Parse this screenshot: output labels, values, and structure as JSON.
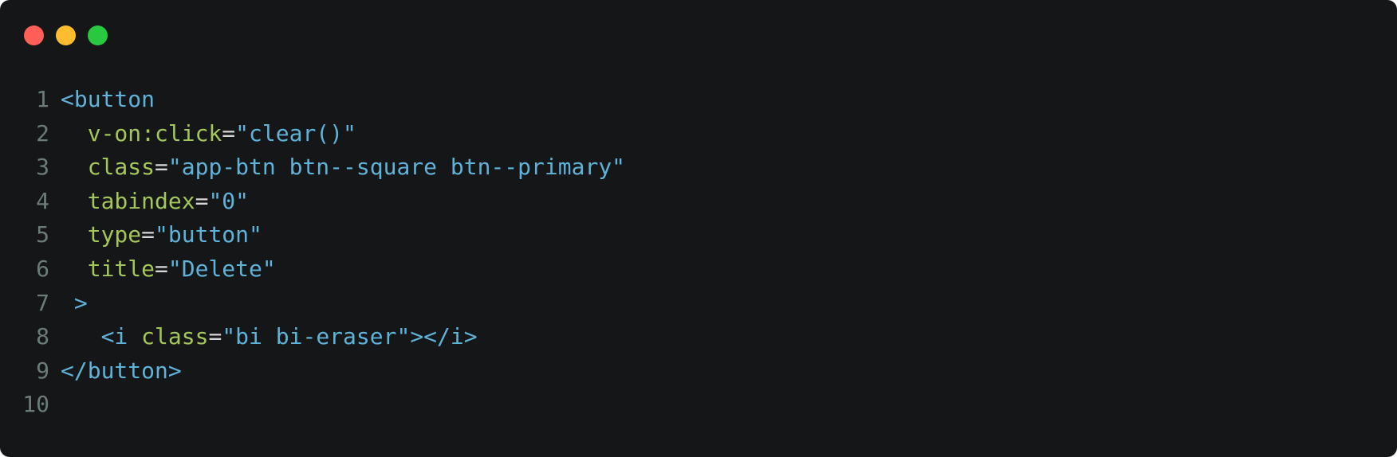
{
  "window": {
    "controls": [
      {
        "name": "close",
        "color": "#ff5f57"
      },
      {
        "name": "minimize",
        "color": "#febc2e"
      },
      {
        "name": "maximize",
        "color": "#28c840"
      }
    ]
  },
  "colors": {
    "background": "#151618",
    "line_number": "#6b7c78",
    "tag": "#5fb3d9",
    "attribute": "#a3c75a",
    "string": "#5fb3d9",
    "punctuation": "#d7d7d7"
  },
  "code": {
    "lines": [
      {
        "num": "1",
        "tokens": [
          {
            "t": "<button",
            "k": "tag"
          }
        ]
      },
      {
        "num": "2",
        "tokens": [
          {
            "t": "  ",
            "k": "punct"
          },
          {
            "t": "v-on:click",
            "k": "attr"
          },
          {
            "t": "=",
            "k": "punct"
          },
          {
            "t": "\"clear()\"",
            "k": "str"
          }
        ]
      },
      {
        "num": "3",
        "tokens": [
          {
            "t": "  ",
            "k": "punct"
          },
          {
            "t": "class",
            "k": "attr"
          },
          {
            "t": "=",
            "k": "punct"
          },
          {
            "t": "\"app-btn btn--square btn--primary\"",
            "k": "str"
          }
        ]
      },
      {
        "num": "4",
        "tokens": [
          {
            "t": "  ",
            "k": "punct"
          },
          {
            "t": "tabindex",
            "k": "attr"
          },
          {
            "t": "=",
            "k": "punct"
          },
          {
            "t": "\"0\"",
            "k": "str"
          }
        ]
      },
      {
        "num": "5",
        "tokens": [
          {
            "t": "  ",
            "k": "punct"
          },
          {
            "t": "type",
            "k": "attr"
          },
          {
            "t": "=",
            "k": "punct"
          },
          {
            "t": "\"button\"",
            "k": "str"
          }
        ]
      },
      {
        "num": "6",
        "tokens": [
          {
            "t": "  ",
            "k": "punct"
          },
          {
            "t": "title",
            "k": "attr"
          },
          {
            "t": "=",
            "k": "punct"
          },
          {
            "t": "\"Delete\"",
            "k": "str"
          }
        ]
      },
      {
        "num": "7",
        "tokens": [
          {
            "t": " ",
            "k": "punct"
          },
          {
            "t": ">",
            "k": "tag"
          }
        ]
      },
      {
        "num": "8",
        "tokens": [
          {
            "t": "   ",
            "k": "punct"
          },
          {
            "t": "<i ",
            "k": "tag"
          },
          {
            "t": "class",
            "k": "attr"
          },
          {
            "t": "=",
            "k": "punct"
          },
          {
            "t": "\"bi bi-eraser\"",
            "k": "str"
          },
          {
            "t": "></i>",
            "k": "tag"
          }
        ]
      },
      {
        "num": "9",
        "tokens": [
          {
            "t": "</button>",
            "k": "tag"
          }
        ]
      },
      {
        "num": "10",
        "tokens": []
      }
    ]
  }
}
